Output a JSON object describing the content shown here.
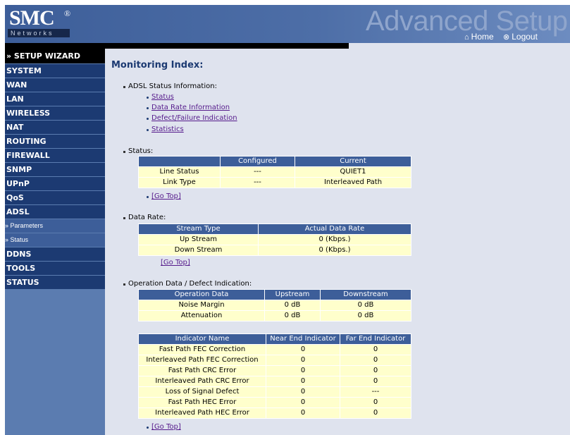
{
  "header": {
    "logo_main": "SMC",
    "logo_reg": "®",
    "logo_sub": "Networks",
    "banner_title": "Advanced Setup",
    "home_label": "Home",
    "logout_label": "Logout"
  },
  "sidebar": {
    "wizard": "» SETUP WIZARD",
    "items": [
      "SYSTEM",
      "WAN",
      "LAN",
      "WIRELESS",
      "NAT",
      "ROUTING",
      "FIREWALL",
      "SNMP",
      "UPnP",
      "QoS",
      "ADSL"
    ],
    "sub_items": [
      "» Parameters",
      "» Status"
    ],
    "items_after": [
      "DDNS",
      "TOOLS",
      "STATUS"
    ]
  },
  "main": {
    "title": "Monitoring Index:",
    "adsl_heading": "ADSL Status Information:",
    "index_links": [
      "Status",
      "Data Rate Information",
      "Defect/Failure Indication",
      "Statistics"
    ],
    "go_top": "[Go Top]",
    "status": {
      "heading": "Status:",
      "columns": [
        "",
        "Configured",
        "Current"
      ],
      "rows": [
        [
          "Line Status",
          "---",
          "QUIET1"
        ],
        [
          "Link Type",
          "---",
          "Interleaved Path"
        ]
      ]
    },
    "data_rate": {
      "heading": "Data Rate:",
      "columns": [
        "Stream Type",
        "Actual Data Rate"
      ],
      "rows": [
        [
          "Up Stream",
          "0 (Kbps.)"
        ],
        [
          "Down Stream",
          "0 (Kbps.)"
        ]
      ]
    },
    "operation": {
      "heading": "Operation Data / Defect Indication:",
      "columns": [
        "Operation Data",
        "Upstream",
        "Downstream"
      ],
      "rows": [
        [
          "Noise Margin",
          "0 dB",
          "0 dB"
        ],
        [
          "Attenuation",
          "0 dB",
          "0 dB"
        ]
      ]
    },
    "indicators": {
      "columns": [
        "Indicator Name",
        "Near End Indicator",
        "Far End Indicator"
      ],
      "rows": [
        [
          "Fast Path FEC Correction",
          "0",
          "0"
        ],
        [
          "Interleaved Path FEC Correction",
          "0",
          "0"
        ],
        [
          "Fast Path CRC Error",
          "0",
          "0"
        ],
        [
          "Interleaved Path CRC Error",
          "0",
          "0"
        ],
        [
          "Loss of Signal Defect",
          "0",
          "---"
        ],
        [
          "Fast Path HEC Error",
          "0",
          "0"
        ],
        [
          "Interleaved Path HEC Error",
          "0",
          "0"
        ]
      ]
    }
  }
}
